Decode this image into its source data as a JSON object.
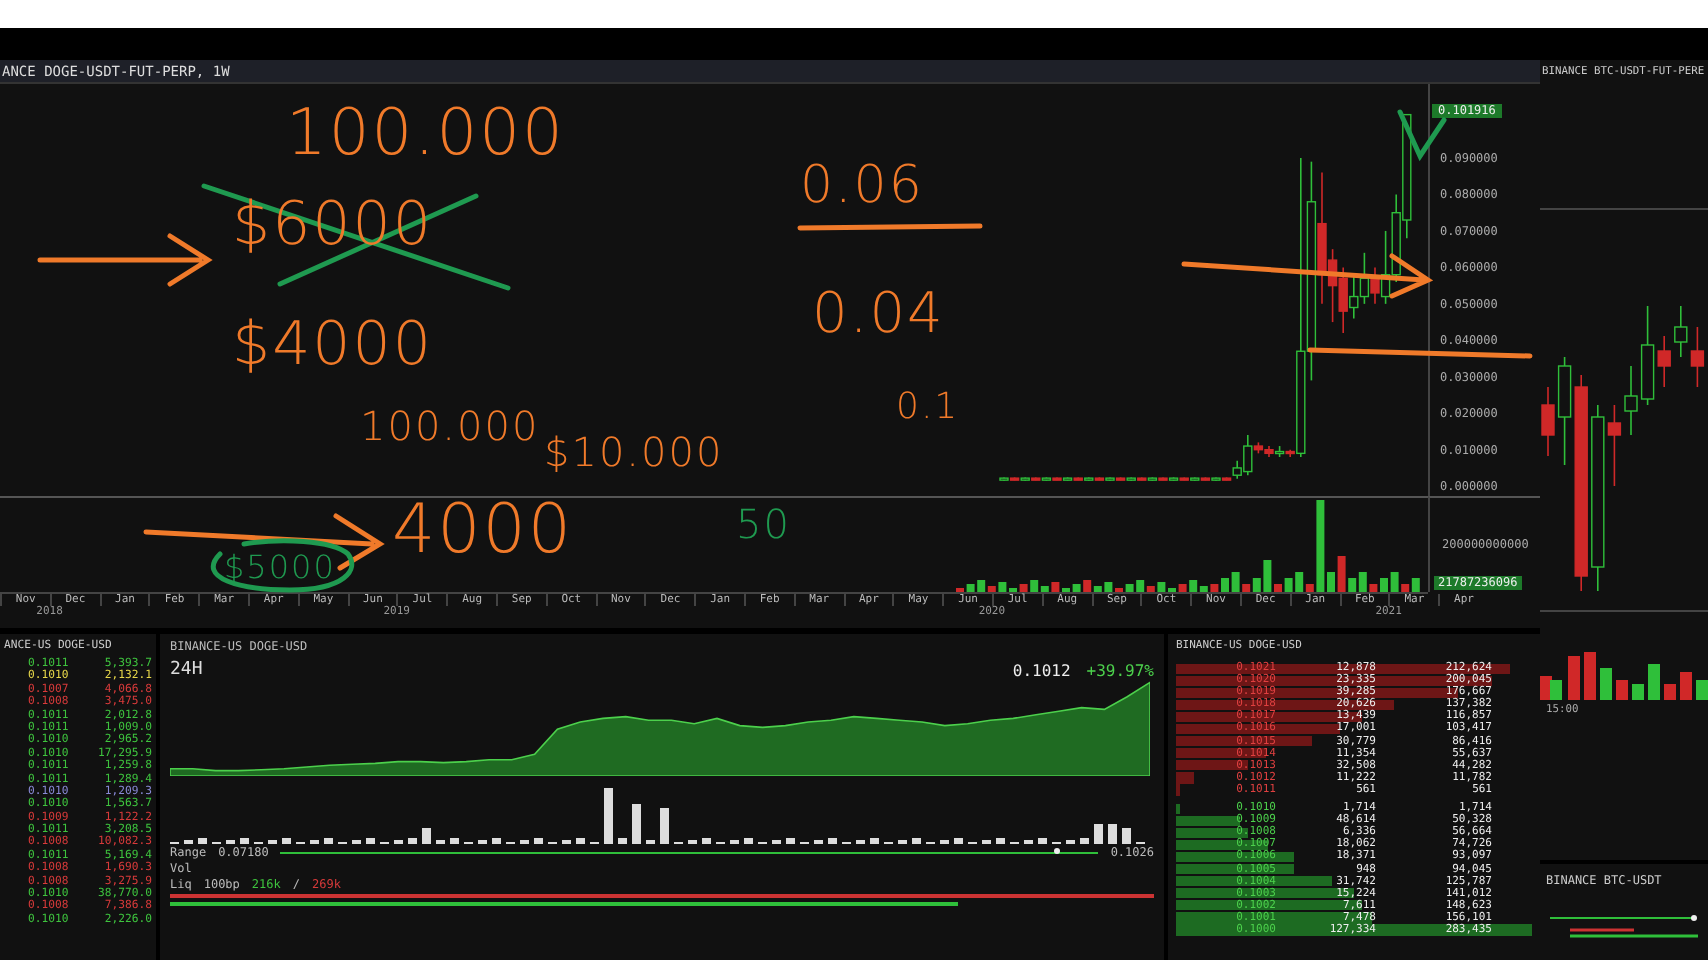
{
  "main_chart": {
    "title": "ANCE DOGE-USDT-FUT-PERP, 1W",
    "chart_data": {
      "type": "candlestick",
      "categories": [
        null,
        null,
        null,
        null,
        null,
        null,
        null,
        null,
        null,
        null,
        null,
        null,
        null,
        null,
        null,
        null,
        null,
        null,
        null,
        null,
        null,
        null,
        null,
        null,
        null,
        null,
        null,
        null,
        null,
        null,
        null,
        null,
        null,
        null,
        null,
        null,
        null,
        null,
        null
      ],
      "ohlc": [
        [
          0.0018,
          0.0024,
          0.0015,
          0.0022
        ],
        [
          0.0022,
          0.0024,
          0.0016,
          0.0018
        ],
        [
          0.0018,
          0.0024,
          0.0015,
          0.0022
        ],
        [
          0.0022,
          0.0024,
          0.0016,
          0.0018
        ],
        [
          0.0018,
          0.0024,
          0.0015,
          0.0022
        ],
        [
          0.0022,
          0.0024,
          0.0016,
          0.0018
        ],
        [
          0.0018,
          0.0024,
          0.0015,
          0.0022
        ],
        [
          0.0022,
          0.0024,
          0.0016,
          0.0018
        ],
        [
          0.0018,
          0.0024,
          0.0015,
          0.0022
        ],
        [
          0.0022,
          0.0024,
          0.0016,
          0.0018
        ],
        [
          0.0018,
          0.0024,
          0.0015,
          0.0022
        ],
        [
          0.0022,
          0.0024,
          0.0016,
          0.0018
        ],
        [
          0.0018,
          0.0024,
          0.0015,
          0.0022
        ],
        [
          0.0022,
          0.0024,
          0.0016,
          0.0018
        ],
        [
          0.0018,
          0.0024,
          0.0015,
          0.0022
        ],
        [
          0.0022,
          0.0024,
          0.0016,
          0.0018
        ],
        [
          0.0018,
          0.0024,
          0.0015,
          0.0022
        ],
        [
          0.0022,
          0.0024,
          0.0016,
          0.0018
        ],
        [
          0.0018,
          0.0024,
          0.0015,
          0.0022
        ],
        [
          0.0022,
          0.0024,
          0.0016,
          0.0018
        ],
        [
          0.0018,
          0.0024,
          0.0015,
          0.0022
        ],
        [
          0.0022,
          0.0024,
          0.0016,
          0.0018
        ],
        [
          0.003,
          0.007,
          0.002,
          0.005
        ],
        [
          0.004,
          0.014,
          0.003,
          0.011
        ],
        [
          0.011,
          0.012,
          0.009,
          0.01
        ],
        [
          0.01,
          0.011,
          0.008,
          0.009
        ],
        [
          0.009,
          0.011,
          0.008,
          0.0095
        ],
        [
          0.0095,
          0.01,
          0.008,
          0.009
        ],
        [
          0.009,
          0.09,
          0.008,
          0.037
        ],
        [
          0.037,
          0.089,
          0.029,
          0.078
        ],
        [
          0.072,
          0.086,
          0.05,
          0.058
        ],
        [
          0.062,
          0.065,
          0.045,
          0.055
        ],
        [
          0.057,
          0.06,
          0.042,
          0.048
        ],
        [
          0.049,
          0.058,
          0.046,
          0.052
        ],
        [
          0.052,
          0.064,
          0.05,
          0.057
        ],
        [
          0.057,
          0.06,
          0.05,
          0.053
        ],
        [
          0.052,
          0.07,
          0.05,
          0.058
        ],
        [
          0.058,
          0.08,
          0.056,
          0.075
        ],
        [
          0.073,
          0.102,
          0.068,
          0.1019
        ]
      ],
      "ylim": [
        -0.0027,
        0.1103
      ],
      "yticks": [
        {
          "value": 0.09,
          "label": "0.090000"
        },
        {
          "value": 0.08,
          "label": "0.080000"
        },
        {
          "value": 0.07,
          "label": "0.070000"
        },
        {
          "value": 0.06,
          "label": "0.060000"
        },
        {
          "value": 0.05,
          "label": "0.050000"
        },
        {
          "value": 0.04,
          "label": "0.040000"
        },
        {
          "value": 0.03,
          "label": "0.030000"
        },
        {
          "value": 0.02,
          "label": "0.020000"
        },
        {
          "value": 0.01,
          "label": "0.010000"
        },
        {
          "value": 0,
          "label": "0.000000"
        }
      ]
    },
    "current_price": "0.101916",
    "volume_axis": {
      "label": "200000000000",
      "current": "21787236096"
    },
    "time_axis": [
      {
        "year": "2018",
        "months": [
          "Nov",
          "Dec"
        ]
      },
      {
        "year": "2019",
        "months": [
          "Jan",
          "Feb",
          "Mar",
          "Apr",
          "May",
          "Jun",
          "Jul",
          "Aug",
          "Sep",
          "Oct",
          "Nov",
          "Dec"
        ]
      },
      {
        "year": "2020",
        "months": [
          "Jan",
          "Feb",
          "Mar",
          "Apr",
          "May",
          "Jun",
          "Jul",
          "Aug",
          "Sep",
          "Oct",
          "Nov",
          "Dec"
        ]
      },
      {
        "year": "2021",
        "months": [
          "Jan",
          "Feb",
          "Mar",
          "Apr"
        ]
      }
    ]
  },
  "side_chart": {
    "title": "BINANCE BTC-USDT-FUT-PERE",
    "time_label": "15:00"
  },
  "btc_panel": {
    "title": "BINANCE BTC-USDT"
  },
  "trades": {
    "title": "ANCE-US DOGE-USD",
    "rows": [
      {
        "price": "0.1011",
        "size": "5,393.7",
        "color": "#3ec43e"
      },
      {
        "price": "0.1010",
        "size": "2,132.1",
        "color": "#e8d84a"
      },
      {
        "price": "0.1007",
        "size": "4,066.8",
        "color": "#d83a3a"
      },
      {
        "price": "0.1008",
        "size": "3,475.0",
        "color": "#d83a3a"
      },
      {
        "price": "0.1011",
        "size": "2,012.8",
        "color": "#3ec43e"
      },
      {
        "price": "0.1011",
        "size": "1,009.0",
        "color": "#3ec43e"
      },
      {
        "price": "0.1010",
        "size": "2,965.2",
        "color": "#3ec43e"
      },
      {
        "price": "0.1010",
        "size": "17,295.9",
        "color": "#3ec43e"
      },
      {
        "price": "0.1011",
        "size": "1,259.8",
        "color": "#3ec43e"
      },
      {
        "price": "0.1011",
        "size": "1,289.4",
        "color": "#3ec43e"
      },
      {
        "price": "0.1010",
        "size": "1,209.3",
        "color": "#8a8ad8"
      },
      {
        "price": "0.1010",
        "size": "1,563.7",
        "color": "#3ec43e"
      },
      {
        "price": "0.1009",
        "size": "1,122.2",
        "color": "#d83a3a"
      },
      {
        "price": "0.1011",
        "size": "3,208.5",
        "color": "#3ec43e"
      },
      {
        "price": "0.1008",
        "size": "10,082.3",
        "color": "#d83a3a"
      },
      {
        "price": "0.1011",
        "size": "5,169.4",
        "color": "#3ec43e"
      },
      {
        "price": "0.1008",
        "size": "1,690.3",
        "color": "#d83a3a"
      },
      {
        "price": "0.1008",
        "size": "3,275.9",
        "color": "#d83a3a"
      },
      {
        "price": "0.1010",
        "size": "38,770.0",
        "color": "#3ec43e"
      },
      {
        "price": "0.1008",
        "size": "7,386.8",
        "color": "#d83a3a"
      },
      {
        "price": "0.1010",
        "size": "2,226.0",
        "color": "#3ec43e"
      }
    ]
  },
  "market": {
    "title": "BINANCE-US DOGE-USD",
    "period": "24H",
    "price": "0.1012",
    "change": "+39.97%",
    "range": {
      "label": "Range",
      "low": "0.07180",
      "high": "0.1026",
      "level": 0.95
    },
    "vol_label": "Vol",
    "liq": {
      "label": "Liq",
      "depth": "100bp",
      "bid": "216k",
      "separator": "/",
      "ask": "269k",
      "bid_bar": {
        "level": 0.8
      },
      "ask_bar": {
        "level": 1
      }
    }
  },
  "order_book": {
    "title": "BINANCE-US DOGE-USD",
    "asks": [
      {
        "price": "0.1021",
        "size": "12,878",
        "total": "212,624",
        "level": 0.94
      },
      {
        "price": "0.1020",
        "size": "23,335",
        "total": "200,045",
        "level": 0.89
      },
      {
        "price": "0.1019",
        "size": "39,285",
        "total": "176,667",
        "level": 0.79
      },
      {
        "price": "0.1018",
        "size": "20,626",
        "total": "137,382",
        "level": 0.61
      },
      {
        "price": "0.1017",
        "size": "13,439",
        "total": "116,857",
        "level": 0.52
      },
      {
        "price": "0.1016",
        "size": "17,001",
        "total": "103,417",
        "level": 0.46
      },
      {
        "price": "0.1015",
        "size": "30,779",
        "total": "86,416",
        "level": 0.38
      },
      {
        "price": "0.1014",
        "size": "11,354",
        "total": "55,637",
        "level": 0.25
      },
      {
        "price": "0.1013",
        "size": "32,508",
        "total": "44,282",
        "level": 0.2
      },
      {
        "price": "0.1012",
        "size": "11,222",
        "total": "11,782",
        "level": 0.05
      },
      {
        "price": "0.1011",
        "size": "561",
        "total": "561",
        "level": 0.01
      }
    ],
    "bids": [
      {
        "price": "0.1010",
        "size": "1,714",
        "total": "1,714",
        "level": 0.01
      },
      {
        "price": "0.1009",
        "size": "48,614",
        "total": "50,328",
        "level": 0.18
      },
      {
        "price": "0.1008",
        "size": "6,336",
        "total": "56,664",
        "level": 0.2
      },
      {
        "price": "0.1007",
        "size": "18,062",
        "total": "74,726",
        "level": 0.26
      },
      {
        "price": "0.1006",
        "size": "18,371",
        "total": "93,097",
        "level": 0.33
      },
      {
        "price": "0.1005",
        "size": "948",
        "total": "94,045",
        "level": 0.33
      },
      {
        "price": "0.1004",
        "size": "31,742",
        "total": "125,787",
        "level": 0.44
      },
      {
        "price": "0.1003",
        "size": "15,224",
        "total": "141,012",
        "level": 0.5
      },
      {
        "price": "0.1002",
        "size": "7,611",
        "total": "148,623",
        "level": 0.52
      },
      {
        "price": "0.1001",
        "size": "7,478",
        "total": "156,101",
        "level": 0.55
      },
      {
        "price": "0.1000",
        "size": "127,334",
        "total": "283,435",
        "level": 1
      }
    ]
  },
  "annotations": [
    {
      "text": "100.000",
      "color": "#f07a2a"
    },
    {
      "text": "$6000",
      "color": "#f07a2a"
    },
    {
      "text": "$4000",
      "color": "#f07a2a"
    },
    {
      "text": "100.000",
      "color": "#f07a2a"
    },
    {
      "text": "$10.000",
      "color": "#f07a2a"
    },
    {
      "text": "4000",
      "color": "#f07a2a"
    },
    {
      "text": "50",
      "color": "#1f9a50"
    },
    {
      "text": "$5000",
      "color": "#1f9a50"
    },
    {
      "text": "0.06",
      "color": "#f07a2a"
    },
    {
      "text": "0.04",
      "color": "#f07a2a"
    },
    {
      "text": "0.1",
      "color": "#f07a2a"
    }
  ]
}
